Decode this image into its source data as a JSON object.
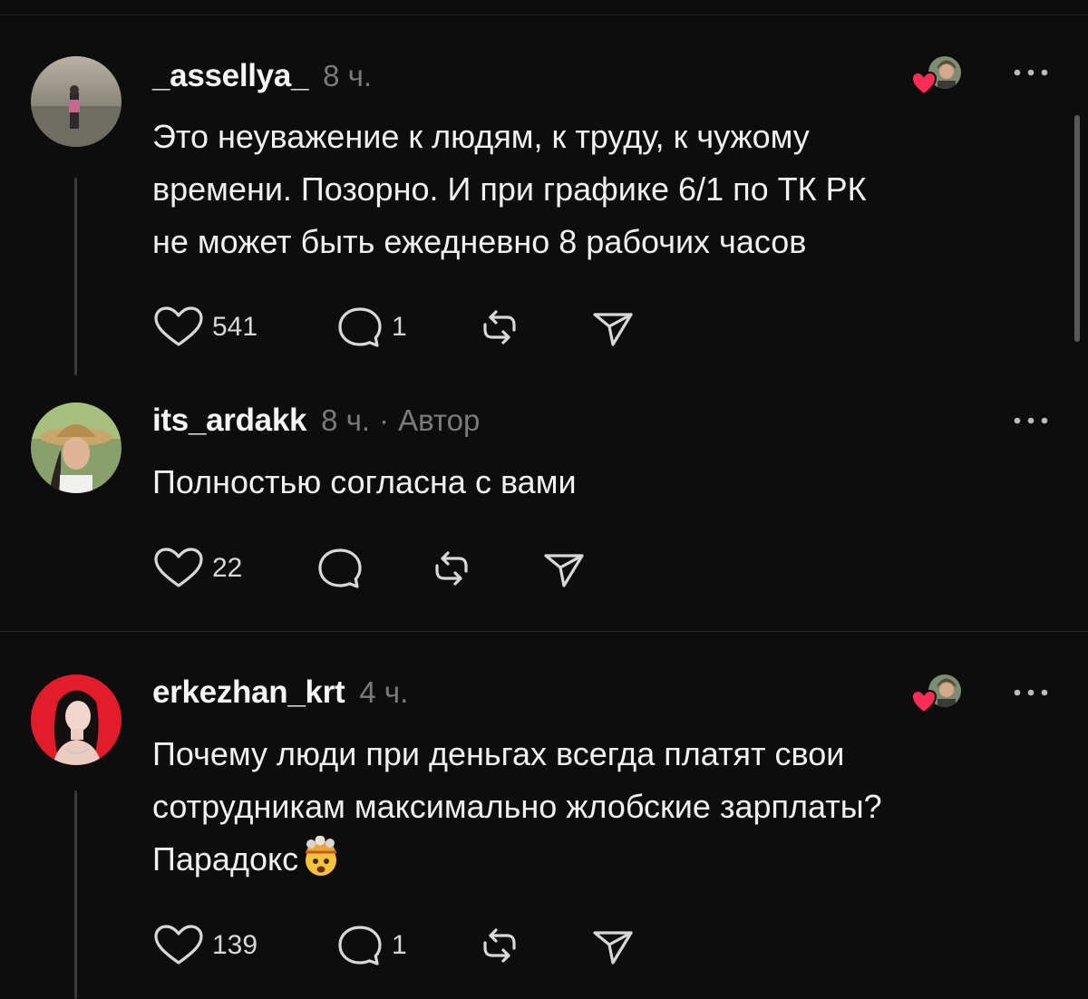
{
  "comments": [
    {
      "username": "_assellya_",
      "time": "8 ч.",
      "lines": [
        "Это неуважение к людям, к труду, к чужому",
        "времени. Позорно. И при графике 6/1 по ТК РК",
        "не может быть ежедневно 8 рабочих часов"
      ],
      "likes": "541",
      "replies": "1"
    },
    {
      "username": "its_ardakk",
      "time": "8 ч.",
      "separator": "·",
      "author_badge": "Автор",
      "lines": [
        "Полностью согласна с вами"
      ],
      "likes": "22"
    },
    {
      "username": "erkezhan_krt",
      "time": "4 ч.",
      "lines": [
        "Почему люди при деньгах всегда платят свои",
        "сотрудникам максимально жлобские зарплаты?",
        "Парадокс"
      ],
      "likes": "139",
      "replies": "1"
    }
  ],
  "icons": {
    "like": "heart-outline-icon",
    "reply": "speech-bubble-icon",
    "repost": "repost-arrows-icon",
    "share": "paper-plane-icon",
    "more": "more-dots-icon",
    "liked_by_author": "heart-badge-icon",
    "emoji": "exploding-head-emoji"
  },
  "colors": {
    "background": "#0d0d0d",
    "text": "#f1f1f1",
    "muted": "#7a7a7a",
    "heart_badge": "#ff2d55"
  }
}
